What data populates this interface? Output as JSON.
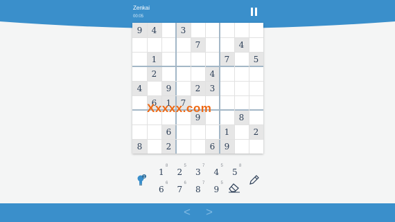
{
  "header": {
    "title": "Zenkai",
    "timer": "00:05"
  },
  "board": {
    "rows": [
      [
        "9",
        "4",
        "",
        "3",
        "",
        "",
        "",
        "",
        ""
      ],
      [
        "",
        "",
        "",
        "",
        "7",
        "",
        "",
        "4",
        ""
      ],
      [
        "",
        "1",
        "",
        "",
        "",
        "",
        "7",
        "",
        "5"
      ],
      [
        "",
        "2",
        "",
        "",
        "",
        "4",
        "",
        "",
        ""
      ],
      [
        "4",
        "",
        "9",
        "",
        "2",
        "3",
        "",
        "",
        ""
      ],
      [
        "",
        "6",
        "1",
        "7",
        "",
        "",
        "",
        "",
        ""
      ],
      [
        "",
        "",
        "",
        "",
        "9",
        "",
        "",
        "8",
        ""
      ],
      [
        "",
        "",
        "6",
        "",
        "",
        "",
        "1",
        "",
        "2"
      ],
      [
        "8",
        "",
        "2",
        "",
        "",
        "6",
        "9",
        "",
        ""
      ]
    ],
    "given": [
      [
        true,
        true,
        false,
        true,
        false,
        false,
        false,
        false,
        false
      ],
      [
        false,
        false,
        false,
        false,
        true,
        false,
        false,
        true,
        false
      ],
      [
        false,
        true,
        false,
        false,
        false,
        false,
        true,
        false,
        true
      ],
      [
        false,
        true,
        false,
        false,
        false,
        true,
        false,
        false,
        false
      ],
      [
        true,
        false,
        true,
        false,
        true,
        true,
        false,
        false,
        false
      ],
      [
        false,
        true,
        true,
        true,
        false,
        false,
        false,
        false,
        false
      ],
      [
        false,
        false,
        false,
        false,
        true,
        false,
        false,
        true,
        false
      ],
      [
        false,
        false,
        true,
        false,
        false,
        false,
        true,
        false,
        true
      ],
      [
        true,
        false,
        true,
        false,
        false,
        true,
        true,
        false,
        false
      ]
    ]
  },
  "watermark": "Xxxxx.com",
  "numberpad": {
    "row1": [
      {
        "digit": "1",
        "remaining": "8"
      },
      {
        "digit": "2",
        "remaining": "5"
      },
      {
        "digit": "3",
        "remaining": "7"
      },
      {
        "digit": "4",
        "remaining": "5"
      },
      {
        "digit": "5",
        "remaining": "8"
      }
    ],
    "row2": [
      {
        "digit": "6",
        "remaining": "6"
      },
      {
        "digit": "7",
        "remaining": "6"
      },
      {
        "digit": "8",
        "remaining": "7"
      },
      {
        "digit": "9",
        "remaining": "5"
      }
    ]
  },
  "colors": {
    "primary": "#3a8fcb",
    "given_cell": "#e6e6e6",
    "digit": "#2c3e56",
    "watermark": "#ee6a16"
  },
  "footer": {
    "prev_label": "<",
    "next_label": ">"
  }
}
